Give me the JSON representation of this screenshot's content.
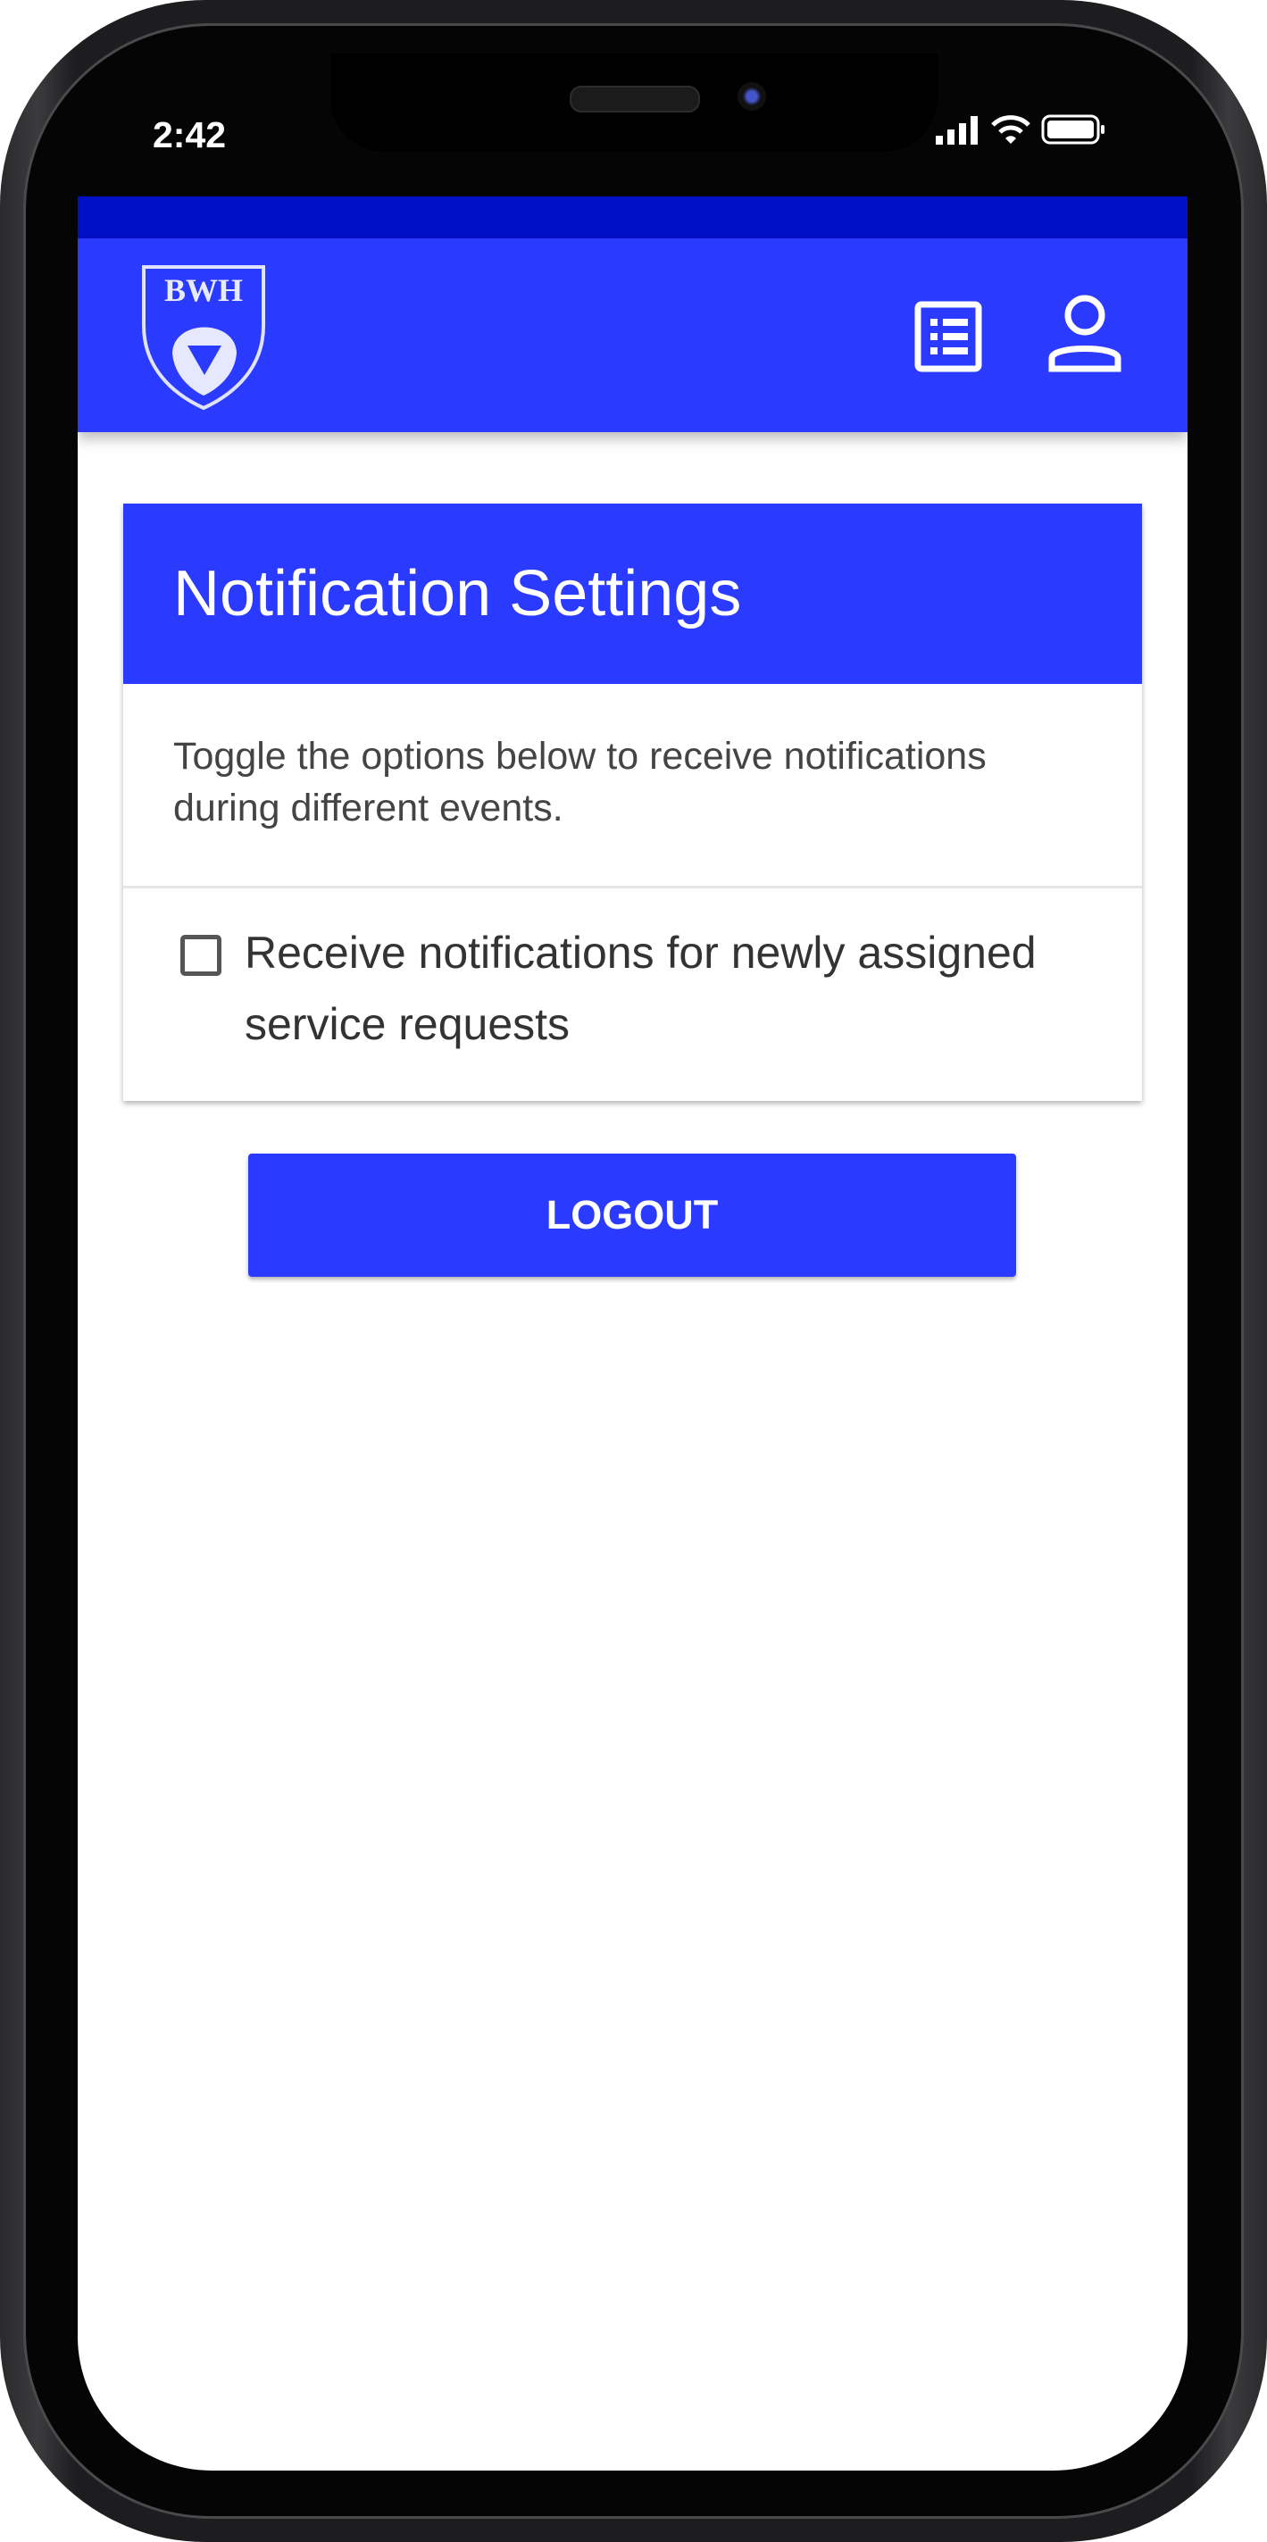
{
  "status_bar": {
    "time": "2:42"
  },
  "header": {
    "logo_text": "BWH",
    "colors": {
      "primary": "#2b3aff",
      "topbar": "#0010c8"
    }
  },
  "card": {
    "title": "Notification Settings",
    "description": "Toggle the options below to receive notifications during different events.",
    "options": [
      {
        "label": "Receive notifications for newly assigned service requests",
        "checked": false
      }
    ]
  },
  "actions": {
    "logout_label": "LOGOUT"
  }
}
